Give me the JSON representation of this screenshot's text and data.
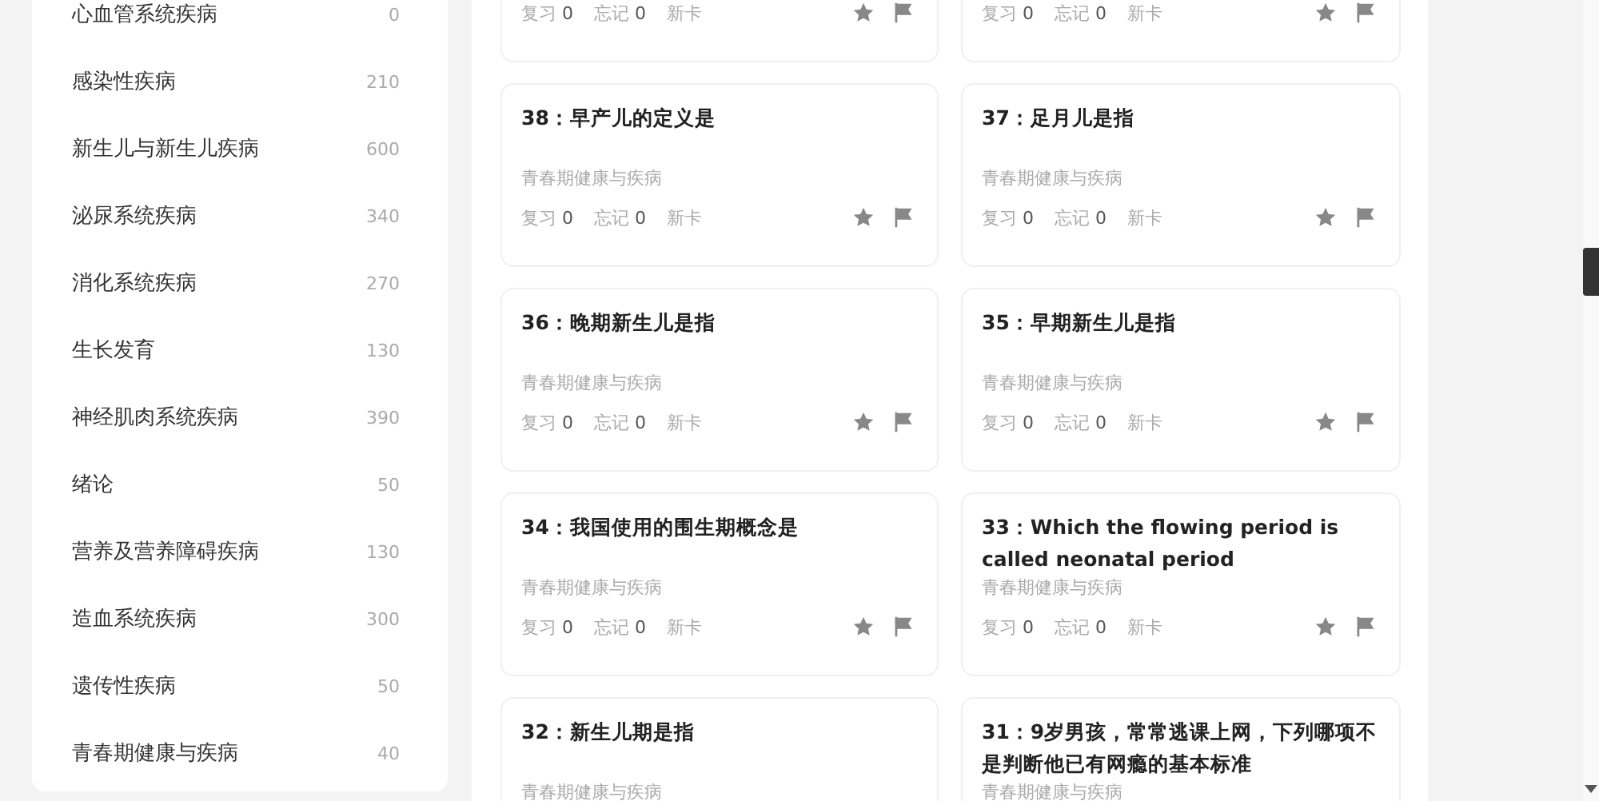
{
  "sidebar": {
    "items": [
      {
        "name": "心血管系统疾病",
        "count": "0"
      },
      {
        "name": "感染性疾病",
        "count": "210"
      },
      {
        "name": "新生儿与新生儿疾病",
        "count": "600"
      },
      {
        "name": "泌尿系统疾病",
        "count": "340"
      },
      {
        "name": "消化系统疾病",
        "count": "270"
      },
      {
        "name": "生长发育",
        "count": "130"
      },
      {
        "name": "神经肌肉系统疾病",
        "count": "390"
      },
      {
        "name": "绪论",
        "count": "50"
      },
      {
        "name": "营养及营养障碍疾病",
        "count": "130"
      },
      {
        "name": "造血系统疾病",
        "count": "300"
      },
      {
        "name": "遗传性疾病",
        "count": "50"
      },
      {
        "name": "青春期健康与疾病",
        "count": "40"
      }
    ]
  },
  "cards": [
    {
      "kind": "cut",
      "stats": [
        {
          "label": "复习",
          "value": "0"
        },
        {
          "label": "忘记",
          "value": "0"
        },
        {
          "label": "新卡"
        }
      ]
    },
    {
      "kind": "cut",
      "stats": [
        {
          "label": "复习",
          "value": "0"
        },
        {
          "label": "忘记",
          "value": "0"
        },
        {
          "label": "新卡"
        }
      ]
    },
    {
      "kind": "full",
      "title": "38：早产儿的定义是",
      "category": "青春期健康与疾病",
      "stats": [
        {
          "label": "复习",
          "value": "0"
        },
        {
          "label": "忘记",
          "value": "0"
        },
        {
          "label": "新卡"
        }
      ]
    },
    {
      "kind": "full",
      "title": "37：足月儿是指",
      "category": "青春期健康与疾病",
      "stats": [
        {
          "label": "复习",
          "value": "0"
        },
        {
          "label": "忘记",
          "value": "0"
        },
        {
          "label": "新卡"
        }
      ]
    },
    {
      "kind": "full",
      "title": "36：晚期新生儿是指",
      "category": "青春期健康与疾病",
      "stats": [
        {
          "label": "复习",
          "value": "0"
        },
        {
          "label": "忘记",
          "value": "0"
        },
        {
          "label": "新卡"
        }
      ]
    },
    {
      "kind": "full",
      "title": "35：早期新生儿是指",
      "category": "青春期健康与疾病",
      "stats": [
        {
          "label": "复习",
          "value": "0"
        },
        {
          "label": "忘记",
          "value": "0"
        },
        {
          "label": "新卡"
        }
      ]
    },
    {
      "kind": "full",
      "title": "34：我国使用的围生期概念是",
      "category": "青春期健康与疾病",
      "stats": [
        {
          "label": "复习",
          "value": "0"
        },
        {
          "label": "忘记",
          "value": "0"
        },
        {
          "label": "新卡"
        }
      ]
    },
    {
      "kind": "full",
      "title": "33：Which the flowing period is called neonatal period",
      "category": "青春期健康与疾病",
      "stats": [
        {
          "label": "复习",
          "value": "0"
        },
        {
          "label": "忘记",
          "value": "0"
        },
        {
          "label": "新卡"
        }
      ]
    },
    {
      "kind": "bottom",
      "title": "32：新生儿期是指",
      "category": "青春期健康与疾病"
    },
    {
      "kind": "bottom",
      "title": "31：9岁男孩，常常逃课上网，下列哪项不是判断他已有网瘾的基本标准",
      "category": "青春期健康与疾病"
    }
  ]
}
